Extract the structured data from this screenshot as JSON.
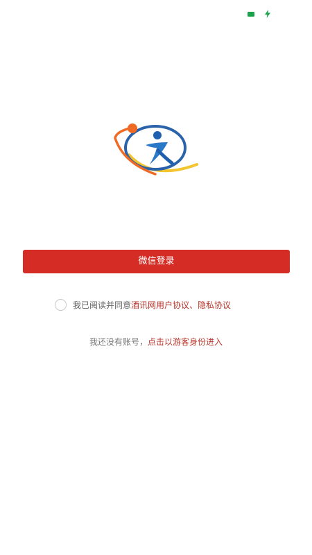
{
  "status_bar": {
    "battery_icon": "battery-icon",
    "charging_icon": "charging-icon",
    "icon_color": "#1aa34a"
  },
  "logo": {
    "icon": "app-logo"
  },
  "login": {
    "label": "微信登录",
    "color": "#d52d26"
  },
  "agreement": {
    "prefix": "我已阅读并同意",
    "link_text": "酒讯网用户协议、隐私协议",
    "link_color": "#b8352a"
  },
  "guest": {
    "prefix": "我还没有账号，",
    "link_text": "点击以游客身份进入"
  }
}
